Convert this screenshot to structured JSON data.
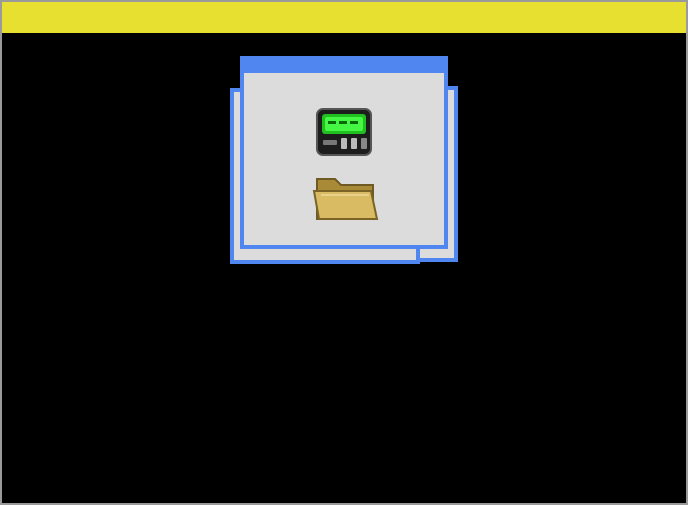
{
  "screen": {
    "top_bar_color": "#e8e030",
    "background_color": "#000000"
  },
  "window_stack": {
    "accent_color": "#4f86f0",
    "panel_color": "#dcdcdc",
    "icons": [
      {
        "name": "pager-device-icon",
        "color": "#33dd33"
      },
      {
        "name": "folder-icon",
        "color": "#d6b45a"
      }
    ]
  }
}
